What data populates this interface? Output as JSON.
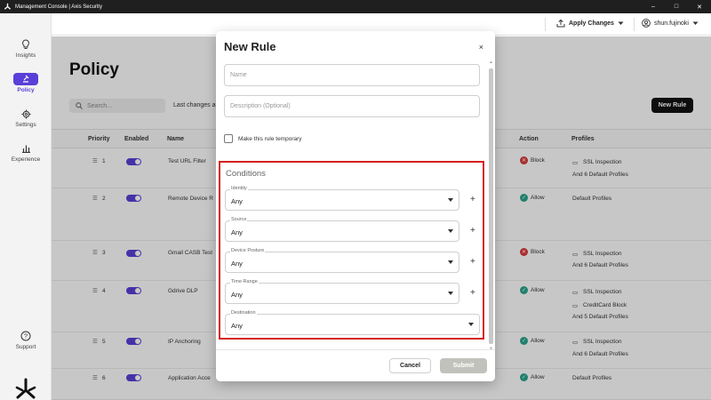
{
  "window": {
    "title": "Management Console | Axis Security",
    "minimize": "–",
    "maximize": "□",
    "close": "✕"
  },
  "sidebar": {
    "items": [
      {
        "label": "Insights",
        "icon": "lightbulb-icon"
      },
      {
        "label": "Policy",
        "icon": "gavel-icon",
        "active": true
      },
      {
        "label": "Settings",
        "icon": "gear-icon"
      },
      {
        "label": "Experience",
        "icon": "bar-chart-icon"
      }
    ],
    "support_label": "Support"
  },
  "topbar": {
    "apply_label": "Apply Changes",
    "user": "shun.fujinoki"
  },
  "page": {
    "title": "Policy",
    "search_placeholder": "Search...",
    "last_changes": "Last changes ap",
    "new_rule": "New Rule"
  },
  "table": {
    "headers": [
      "Priority",
      "Enabled",
      "Name",
      "Action",
      "Profiles"
    ],
    "rows": [
      {
        "priority": "1",
        "name": "Test URL Filter",
        "action": "Block",
        "profiles": [
          "SSL Inspection",
          "And 6 Default Profiles"
        ]
      },
      {
        "priority": "2",
        "name": "Remote Device R",
        "action": "Allow",
        "profiles": [
          "Default Profiles"
        ]
      },
      {
        "priority": "3",
        "name": "Gmail CASB Test",
        "action": "Block",
        "profiles": [
          "SSL Inspection",
          "And 6 Default Profiles"
        ]
      },
      {
        "priority": "4",
        "name": "Gdrive DLP",
        "action": "Allow",
        "profiles": [
          "SSL Inspection",
          "CreditCard Block",
          "And 5 Default Profiles"
        ]
      },
      {
        "priority": "5",
        "name": "IP Anchoring",
        "action": "Allow",
        "profiles": [
          "SSL Inspection",
          "And 6 Default Profiles"
        ]
      },
      {
        "priority": "6",
        "name": "Application Acce",
        "action": "Allow",
        "profiles": [
          "Default Profiles"
        ]
      }
    ]
  },
  "modal": {
    "title": "New Rule",
    "close": "×",
    "name_placeholder": "Name",
    "description_placeholder": "Description (Optional)",
    "temporary_label": "Make this rule temporary",
    "conditions_title": "Conditions",
    "conditions": [
      {
        "label": "Identity",
        "value": "Any"
      },
      {
        "label": "Source",
        "value": "Any"
      },
      {
        "label": "Device Posture",
        "value": "Any"
      },
      {
        "label": "Time Range",
        "value": "Any"
      },
      {
        "label": "Destination",
        "value": "Any"
      }
    ],
    "plus": "+",
    "cancel": "Cancel",
    "submit": "Submit"
  },
  "colors": {
    "accent": "#5a3fd8",
    "block": "#d93a3a",
    "allow": "#2aa58c",
    "highlight": "#d72020"
  }
}
